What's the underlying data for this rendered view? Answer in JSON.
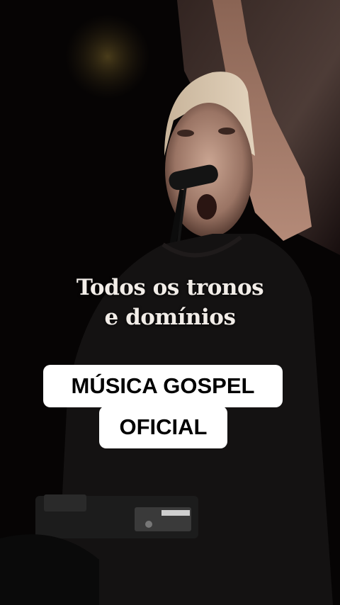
{
  "video": {
    "lyrics": [
      "Todos os tronos",
      "e domínios"
    ],
    "caption": [
      "MÚSICA GOSPEL",
      "OFICIAL"
    ]
  },
  "colors": {
    "caption_background": "#ffffff",
    "caption_text": "#000000",
    "lyric_text": "#f2ede8"
  }
}
